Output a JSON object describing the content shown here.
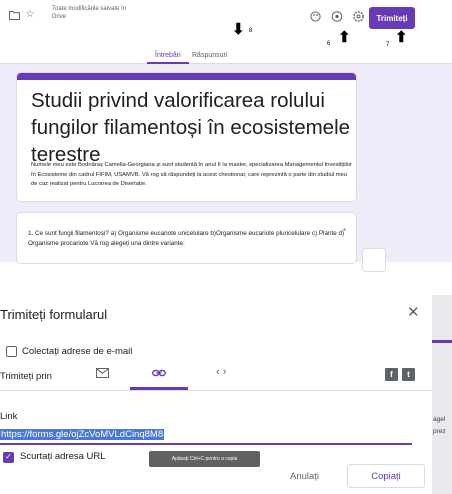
{
  "editor": {
    "saved_status": "Toate modificările salvate în Drive",
    "send_button": "Trimiteți",
    "annotations": {
      "arrow": "⬇",
      "arrow_up": "⬆",
      "n8": "8",
      "n6": "6",
      "n7": "7"
    },
    "tabs": [
      {
        "label": "Întrebări",
        "active": true
      },
      {
        "label": "Răspunsuri",
        "active": false
      }
    ],
    "form_title": "Studii privind valorificarea rolului fungilor filamentoși în ecosistemele terestre",
    "form_description": "Numele meu este Bodnăraș Camelia-Georgiana și sunt studentă în anul II la master, specializarea Managementul Investițiilor în Ecosisteme din cadrul FIFIM, USAMVB. Vă rog să răspundeți la acest chestionar, care reprezintă o parte din studiul meu de caz realizat pentru Lucrarea de Disertație.",
    "question": "1. Ce sunt fungii filamentoși?   a) Organisme eucariote unicelulare b)Organisme eucariote pluricelulare c)  Plante  d) Organisme procariote  Vă rog alegeți una dintre variante:",
    "required_mark": "*",
    "accent_color": "#673ab7"
  },
  "dialog": {
    "title": "Trimiteți formularul",
    "collect_email_label": "Colectați adrese de e-mail",
    "send_via_label": "Trimiteți prin",
    "send_via_icons": [
      "email-icon",
      "link-icon",
      "embed-icon"
    ],
    "social_icons": [
      "facebook-icon",
      "twitter-icon"
    ],
    "link_label": "Link",
    "link_url": "https://forms.gle/ojZcVoMVLdCinq8M8",
    "shorten_label": "Scurtați adresa URL",
    "shorten_checked": true,
    "tooltip": "Apăsați Ctrl+C pentru a copia",
    "cancel_button": "Anulați",
    "copy_button": "Copiați",
    "background_text_1": "agel",
    "background_text_2": "prez"
  }
}
